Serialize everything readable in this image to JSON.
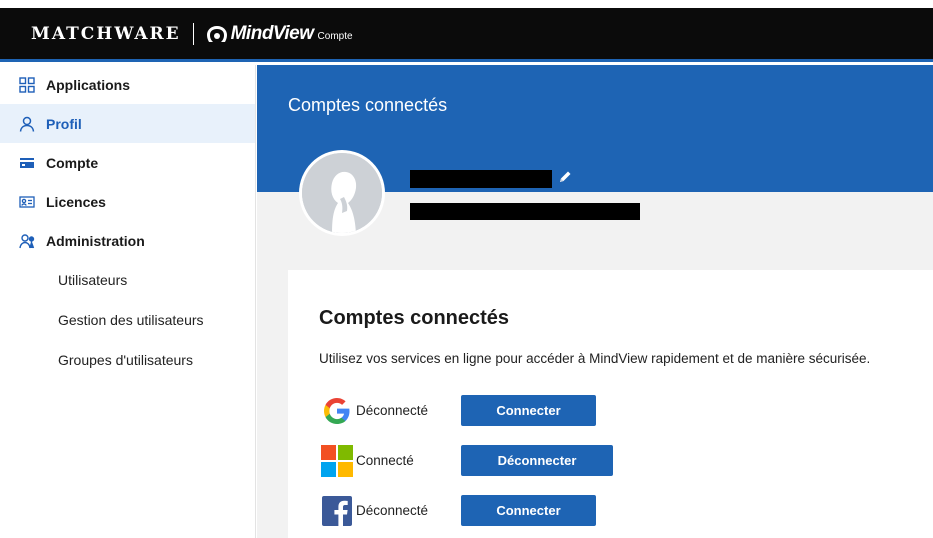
{
  "header": {
    "brand": "MATCHWARE",
    "product": "MindView",
    "product_sub": "Compte",
    "colors": {
      "bar": "#0b0b0b",
      "accent": "#1e64b4"
    }
  },
  "sidebar": {
    "items": [
      {
        "label": "Applications",
        "icon": "grid-icon"
      },
      {
        "label": "Profil",
        "icon": "user-icon",
        "active": true
      },
      {
        "label": "Compte",
        "icon": "credit-card-icon"
      },
      {
        "label": "Licences",
        "icon": "id-card-icon"
      },
      {
        "label": "Administration",
        "icon": "admin-users-icon"
      }
    ],
    "sub_items": [
      "Utilisateurs",
      "Gestion des utilisateurs",
      "Groupes d'utilisateurs"
    ]
  },
  "main": {
    "page_title": "Comptes connectés",
    "profile": {
      "name": "",
      "email": "",
      "avatar": "default-avatar"
    },
    "card": {
      "title": "Comptes connectés",
      "description": "Utilisez vos services en ligne pour accéder à MindView rapidement et de manière sécurisée.",
      "providers": [
        {
          "name": "Google",
          "icon": "google-icon",
          "status": "Déconnecté",
          "button": "Connecter"
        },
        {
          "name": "Microsoft",
          "icon": "microsoft-icon",
          "status": "Connecté",
          "button": "Déconnecter"
        },
        {
          "name": "Facebook",
          "icon": "facebook-icon",
          "status": "Déconnecté",
          "button": "Connecter"
        }
      ]
    }
  }
}
